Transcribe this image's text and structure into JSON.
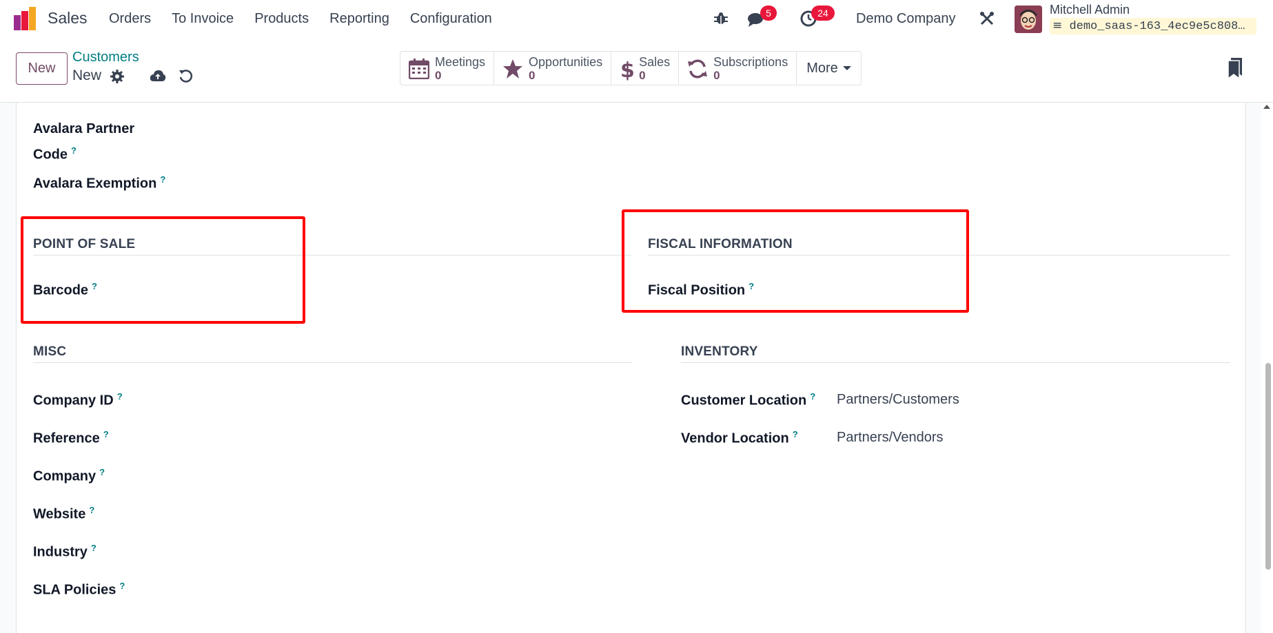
{
  "navbar": {
    "app_name": "Sales",
    "menu": [
      "Orders",
      "To Invoice",
      "Products",
      "Reporting",
      "Configuration"
    ],
    "messages_badge": "5",
    "activities_badge": "24",
    "company": "Demo Company",
    "user_name": "Mitchell Admin",
    "database": "demo_saas-163_4ec9e5c808…"
  },
  "control": {
    "new_label": "New",
    "breadcrumb_parent": "Customers",
    "breadcrumb_current": "New",
    "smart_buttons": [
      {
        "label": "Meetings",
        "value": "0"
      },
      {
        "label": "Opportunities",
        "value": "0"
      },
      {
        "label": "Sales",
        "value": "0"
      },
      {
        "label": "Subscriptions",
        "value": "0"
      }
    ],
    "more_label": "More"
  },
  "form": {
    "avalara_partner_code_line1": "Avalara Partner",
    "avalara_partner_code_line2": "Code",
    "avalara_exemption": "Avalara Exemption",
    "pos_title": "POINT OF SALE",
    "barcode": "Barcode",
    "fiscal_title": "FISCAL INFORMATION",
    "fiscal_position": "Fiscal Position",
    "misc_title": "MISC",
    "misc_fields": [
      "Company ID",
      "Reference",
      "Company",
      "Website",
      "Industry",
      "SLA Policies"
    ],
    "inventory_title": "INVENTORY",
    "customer_location_label": "Customer Location",
    "customer_location_value": "Partners/Customers",
    "vendor_location_label": "Vendor Location",
    "vendor_location_value": "Partners/Vendors",
    "help_mark": "?"
  },
  "colors": {
    "brand": "#714b67",
    "link": "#017e84",
    "badge": "#e8173b",
    "highlight": "#ff0000"
  }
}
